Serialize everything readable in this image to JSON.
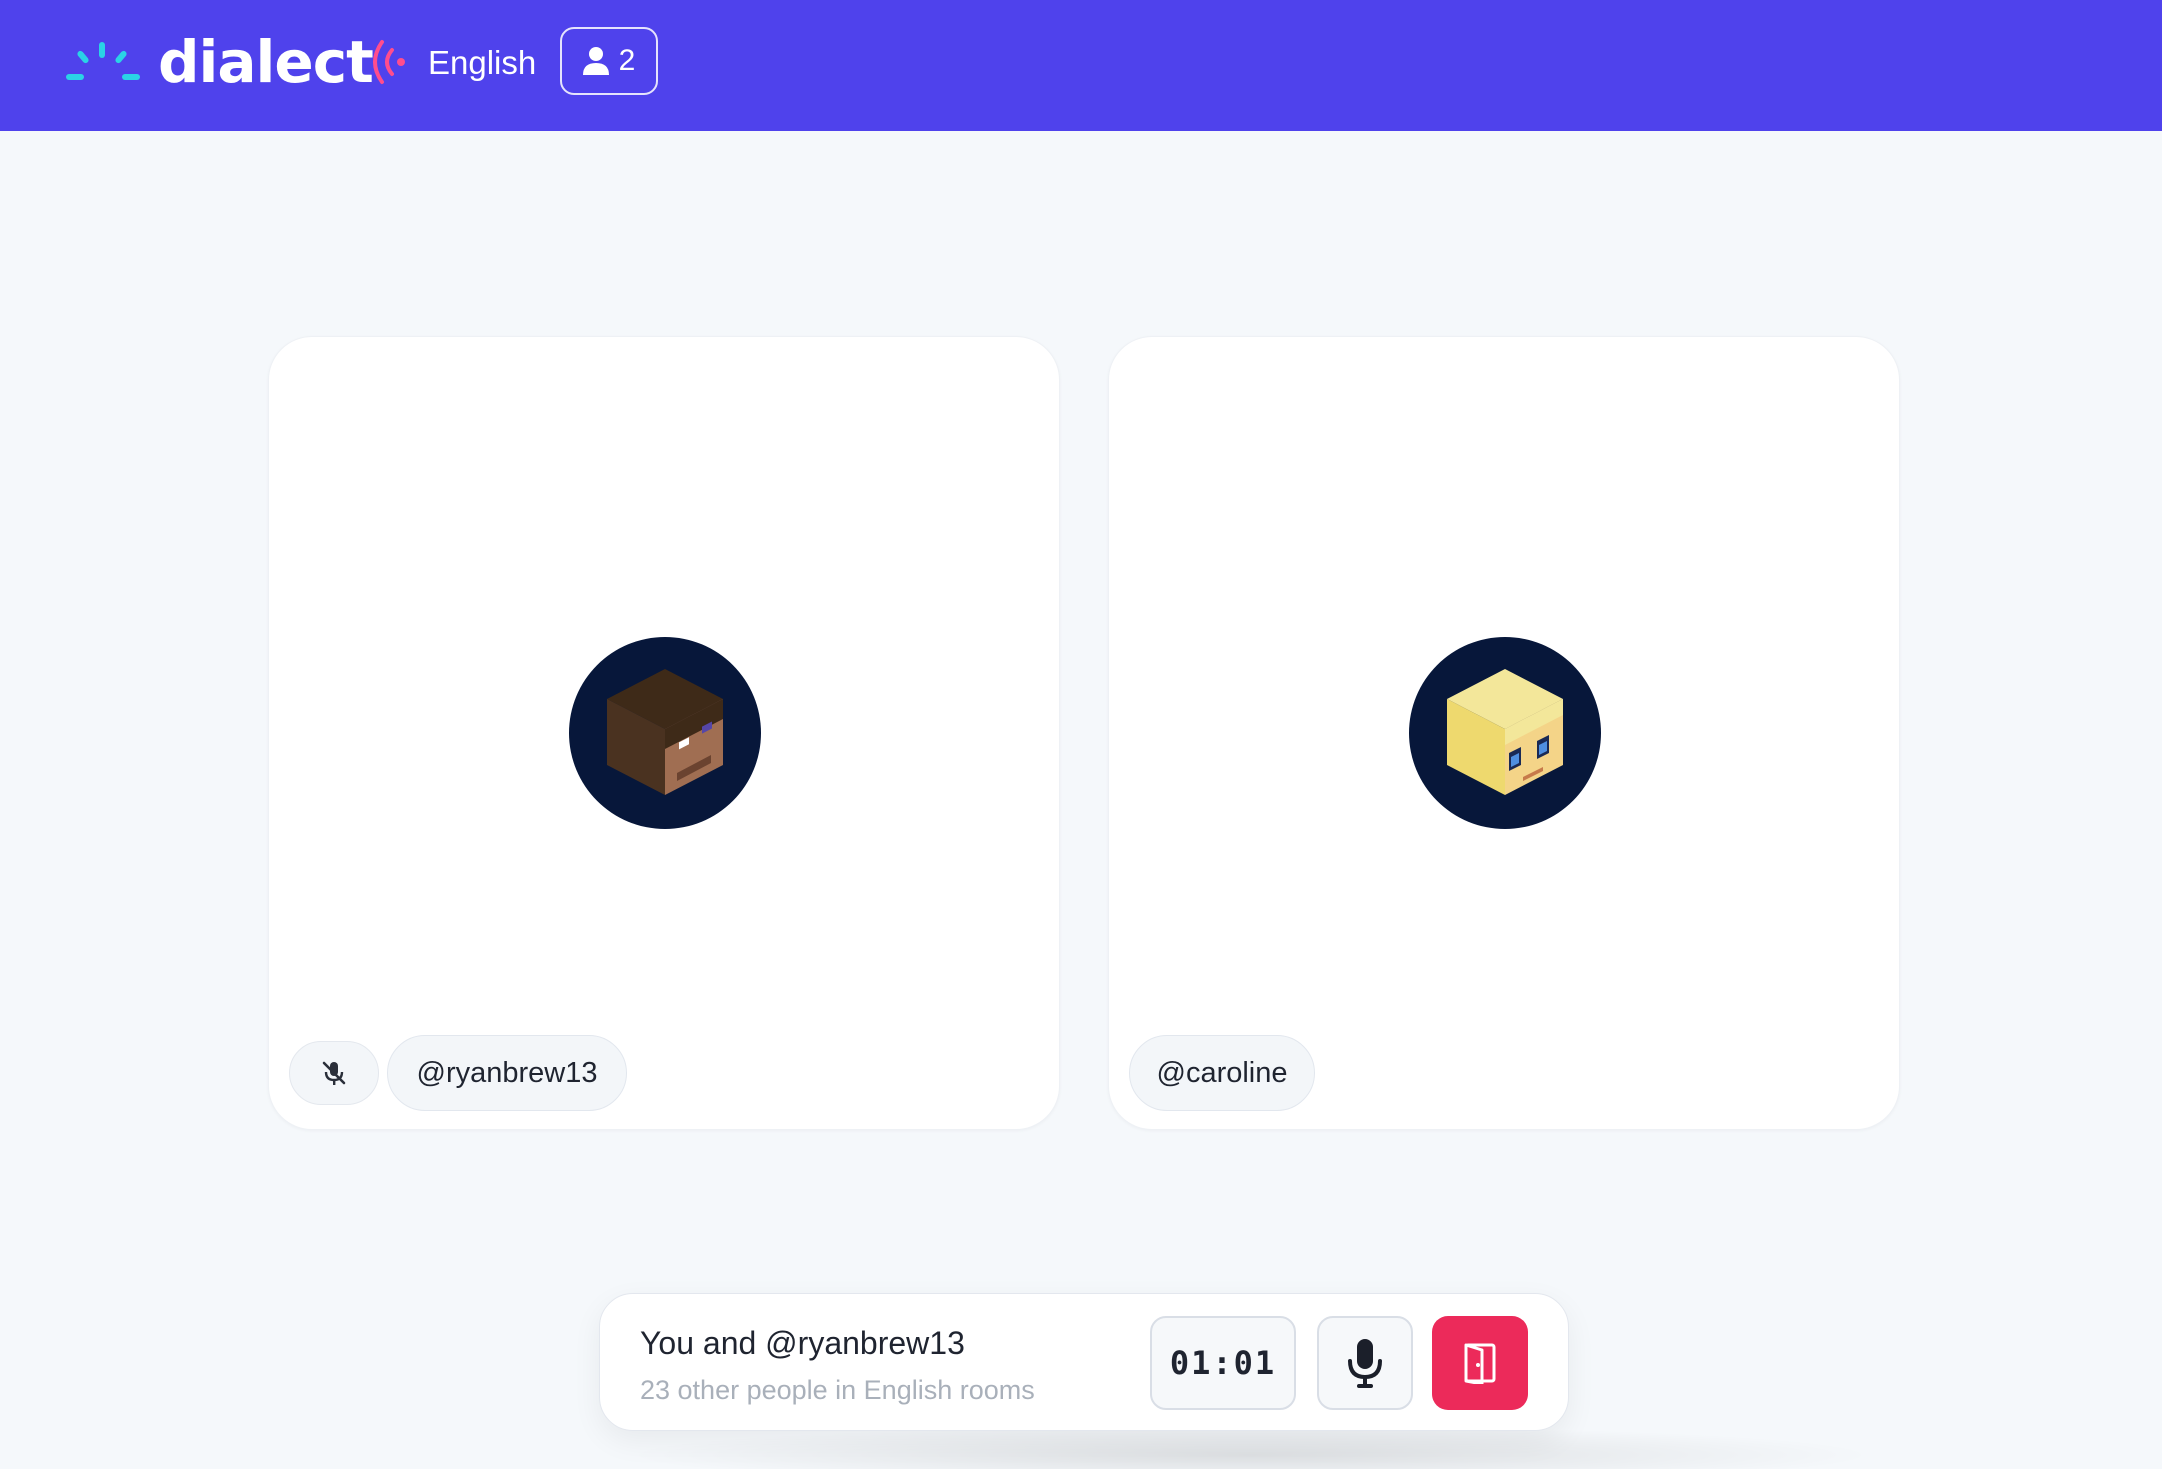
{
  "app": {
    "brand": "dialect",
    "language": "English",
    "participant_count": "2",
    "colors": {
      "header": "#4f42ec",
      "logo_accent": "#2ad3e6",
      "lang_icon": "#ff4d8d",
      "avatar_bg": "#07173a",
      "leave": "#ec2a5a"
    },
    "icons": {
      "logo": "dialect-burst-logo",
      "language": "broadcast-signal-icon",
      "participants": "user-icon"
    }
  },
  "participants": [
    {
      "username": "@ryanbrew13",
      "muted": true,
      "avatar": "brown-hair-blocky-avatar"
    },
    {
      "username": "@caroline",
      "muted": false,
      "avatar": "blonde-blocky-avatar"
    }
  ],
  "call_bar": {
    "title": "You and @ryanbrew13",
    "subtitle": "23 other people in English rooms",
    "timer": "01:01",
    "mic_icon": "microphone-icon",
    "leave_icon": "door-exit-icon"
  }
}
